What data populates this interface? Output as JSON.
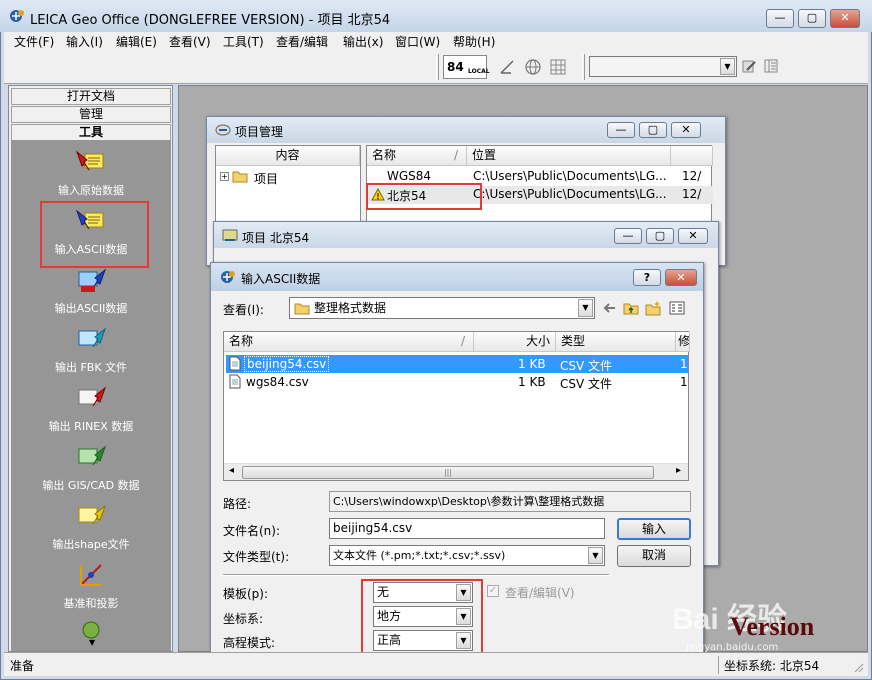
{
  "app": {
    "title": "LEICA Geo Office (DONGLEFREE VERSION) - 项目 北京54",
    "menu": [
      "文件(F)",
      "输入(I)",
      "编辑(E)",
      "查看(V)",
      "工具(T)",
      "查看/编辑",
      "输出(x)",
      "窗口(W)",
      "帮助(H)"
    ],
    "toolbar": {
      "badge_number": "84",
      "badge_sub": "LOCAL"
    },
    "status": {
      "left": "准备",
      "right": "坐标系统: 北京54"
    }
  },
  "left_pane": {
    "tabs": [
      "打开文档",
      "管理",
      "工具"
    ],
    "tools": [
      "输入原始数据",
      "输入ASCII数据",
      "输出ASCII数据",
      "输出 FBK 文件",
      "输出 RINEX 数据",
      "输出 GIS/CAD 数据",
      "输出shape文件",
      "基准和投影"
    ],
    "scroll_indicator": "▼"
  },
  "project_manager": {
    "title": "项目管理",
    "tree_header": "内容",
    "tree_item": "项目",
    "tree_expander": "+",
    "columns": [
      "名称",
      "位置"
    ],
    "rows": [
      {
        "name": "WGS84",
        "location": "C:\\Users\\Public\\Documents\\LG...",
        "date": "12/"
      },
      {
        "name": "北京54",
        "location": "C:\\Users\\Public\\Documents\\LG...",
        "date": "12/"
      }
    ]
  },
  "project_window": {
    "title": "项目 北京54"
  },
  "dialog": {
    "title": "输入ASCII数据",
    "help_btn": "?",
    "close_btn": "✕",
    "lookin_label": "查看(I):",
    "lookin_value": "整理格式数据",
    "columns": [
      "名称",
      "大小",
      "类型",
      "修"
    ],
    "files": [
      {
        "name": "beijing54.csv",
        "size": "1 KB",
        "type": "CSV 文件",
        "mod": "1"
      },
      {
        "name": "wgs84.csv",
        "size": "1 KB",
        "type": "CSV 文件",
        "mod": "1"
      }
    ],
    "scroll_left": "◂",
    "scroll_right": "▸",
    "path_label": "路径:",
    "path_value": "C:\\Users\\windowxp\\Desktop\\参数计算\\整理格式数据",
    "filename_label": "文件名(n):",
    "filename_value": "beijing54.csv",
    "filetype_label": "文件类型(t):",
    "filetype_value": "文本文件 (*.pm;*.txt;*.csv;*.ssv)",
    "open_btn": "输入",
    "cancel_btn": "取消",
    "template_label": "模板(p):",
    "template_value": "无",
    "coord_label": "坐标系:",
    "coord_value": "地方",
    "height_label": "高程模式:",
    "height_value": "正高",
    "view_edit_check": "查看/编辑(V)",
    "check_mark": "✓"
  },
  "watermark": {
    "text": "Bai 经验",
    "url": "jingyan.baidu.com",
    "version": "Version"
  },
  "colors": {
    "accent_red": "#e53935",
    "selection": "#3399ff",
    "tool_panel": "#969696"
  }
}
